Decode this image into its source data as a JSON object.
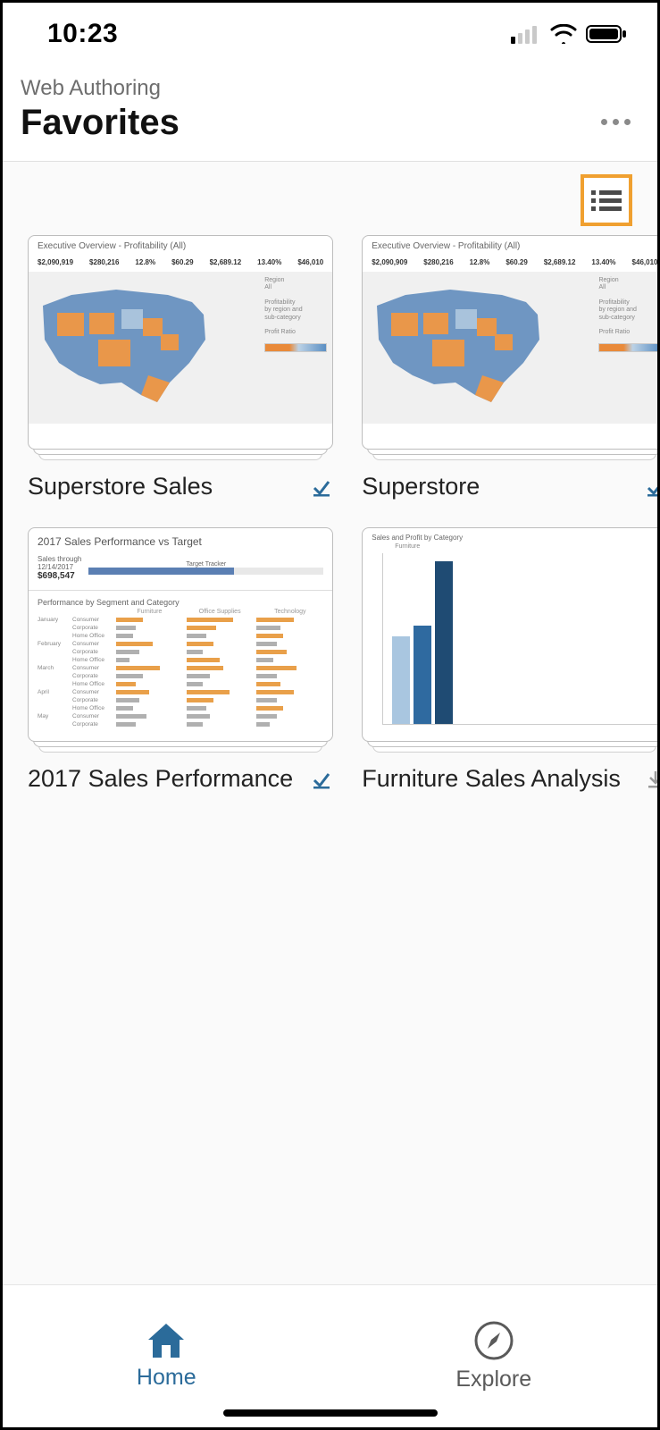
{
  "status": {
    "time": "10:23"
  },
  "header": {
    "subtitle": "Web Authoring",
    "title": "Favorites"
  },
  "cards": [
    {
      "title": "Superstore Sales",
      "badge": "checkmark",
      "thumb": {
        "type": "map",
        "heading": "Executive Overview - Profitability (All)",
        "stats": [
          "$2,090,919",
          "$280,216",
          "12.8%",
          "$60.29",
          "$2,689.12",
          "13.40%",
          "$46,010"
        ]
      }
    },
    {
      "title": "Superstore",
      "badge": "checkmark",
      "thumb": {
        "type": "map",
        "heading": "Executive Overview - Profitability (All)",
        "stats": [
          "$2,090,909",
          "$280,216",
          "12.8%",
          "$60.29",
          "$2,689.12",
          "13.40%",
          "$46,010"
        ]
      }
    },
    {
      "title": "2017 Sales Performance",
      "badge": "checkmark",
      "thumb": {
        "type": "salesperf",
        "heading": "2017 Sales Performance vs Target",
        "sales_label": "Sales through",
        "sales_date": "12/14/2017",
        "sales_value": "$698,547",
        "tracker_label": "Target Tracker",
        "subheading": "Performance by Segment and Category",
        "columns": [
          "Furniture",
          "Office Supplies",
          "Technology"
        ],
        "months": [
          "January",
          "February",
          "March",
          "April",
          "May"
        ],
        "segments": [
          "Consumer",
          "Corporate",
          "Home Office"
        ]
      }
    },
    {
      "title": "Furniture Sales Analysis",
      "badge": "download",
      "thumb": {
        "type": "bars",
        "heading": "Sales and Profit by Category",
        "legend": "Furniture"
      }
    }
  ],
  "nav": {
    "home": "Home",
    "explore": "Explore"
  }
}
